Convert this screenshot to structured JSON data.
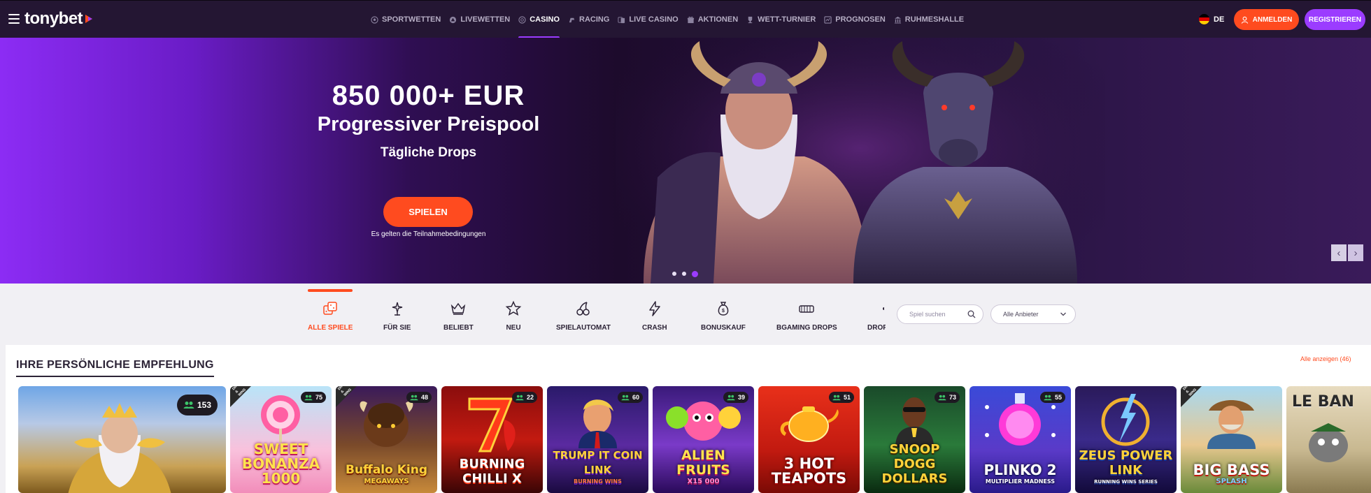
{
  "header": {
    "logo_text": "tonybet",
    "nav": [
      {
        "label": "SPORTWETTEN",
        "icon": "soccer-ball-icon"
      },
      {
        "label": "LIVEWETTEN",
        "icon": "live-icon"
      },
      {
        "label": "CASINO",
        "icon": "casino-chip-icon",
        "active": true
      },
      {
        "label": "RACING",
        "icon": "racing-icon"
      },
      {
        "label": "LIVE CASINO",
        "icon": "live-casino-icon"
      },
      {
        "label": "AKTIONEN",
        "icon": "gift-icon"
      },
      {
        "label": "WETT-TURNIER",
        "icon": "trophy-icon"
      },
      {
        "label": "PROGNOSEN",
        "icon": "predictions-icon"
      },
      {
        "label": "RUHMESHALLE",
        "icon": "hall-of-fame-icon"
      }
    ],
    "language": "DE",
    "login_label": "ANMELDEN",
    "register_label": "REGISTRIEREN"
  },
  "hero": {
    "headline": "850 000+ EUR",
    "subheadline": "Progressiver Preispool",
    "tagline": "Tägliche Drops",
    "cta_label": "SPIELEN",
    "terms": "Es gelten die Teilnahmebedingungen",
    "slide_count": 3,
    "active_slide": 3
  },
  "categories": [
    {
      "label": "ALLE SPIELE",
      "icon": "dice-icon",
      "active": true
    },
    {
      "label": "FÜR SIE",
      "icon": "sparkle-icon"
    },
    {
      "label": "BELIEBT",
      "icon": "crown-icon"
    },
    {
      "label": "NEU",
      "icon": "star-icon"
    },
    {
      "label": "SPIELAUTOMAT",
      "icon": "cherries-icon"
    },
    {
      "label": "CRASH",
      "icon": "lightning-icon"
    },
    {
      "label": "BONUSKAUF",
      "icon": "money-bag-icon"
    },
    {
      "label": "BGAMING DROPS",
      "icon": "bgaming-drops-icon"
    },
    {
      "label": "DROP",
      "icon": "drops-icon"
    }
  ],
  "search": {
    "placeholder": "Spiel suchen"
  },
  "provider_filter": {
    "selected": "Alle Anbieter"
  },
  "recommendations": {
    "title": "IHRE PERSÖNLICHE EMPFEHLUNG",
    "see_all": "Alle anzeigen (46)",
    "games": [
      {
        "title": "",
        "players": "153"
      },
      {
        "title": "SWEET BONANZA 1000",
        "players": "75",
        "ribbon": "DROPS & WINS"
      },
      {
        "title": "Buffalo King",
        "subtitle": "MEGAWAYS",
        "players": "48",
        "ribbon": "DROPS & WINS"
      },
      {
        "title": "BURNING CHILLI X",
        "players": "22"
      },
      {
        "title": "TRUMP IT COIN LINK",
        "subtitle": "BURNING WINS",
        "players": "60"
      },
      {
        "title": "ALIEN FRUITS",
        "subtitle": "X15 000",
        "players": "39"
      },
      {
        "title": "3 HOT TEAPOTS",
        "players": "51"
      },
      {
        "title": "SNOOP DOGG DOLLARS",
        "players": "73"
      },
      {
        "title": "PLINKO 2",
        "subtitle": "MULTIPLIER MADNESS",
        "players": "55"
      },
      {
        "title": "ZEUS POWER LINK",
        "subtitle": "RUNNING WINS SERIES",
        "players": ""
      },
      {
        "title": "BIG BASS",
        "subtitle": "SPLASH",
        "players": "",
        "ribbon": "DROPS & WINS"
      },
      {
        "title": "LE BAN",
        "players": ""
      }
    ]
  },
  "colors": {
    "header_bg": "#241633",
    "accent_orange": "#ff4b1f",
    "accent_purple": "#9b3cff"
  }
}
